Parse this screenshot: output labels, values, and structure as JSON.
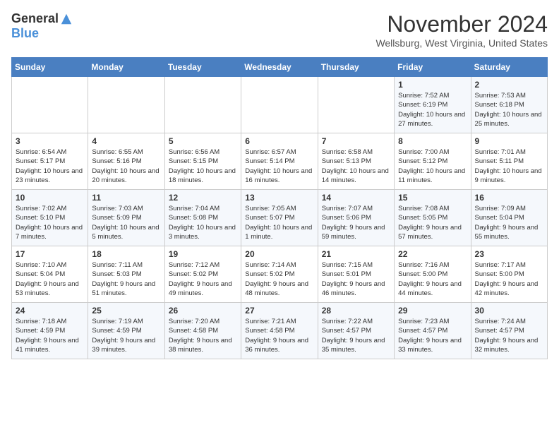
{
  "logo": {
    "general": "General",
    "blue": "Blue"
  },
  "header": {
    "month": "November 2024",
    "location": "Wellsburg, West Virginia, United States"
  },
  "weekdays": [
    "Sunday",
    "Monday",
    "Tuesday",
    "Wednesday",
    "Thursday",
    "Friday",
    "Saturday"
  ],
  "weeks": [
    [
      {
        "day": "",
        "info": ""
      },
      {
        "day": "",
        "info": ""
      },
      {
        "day": "",
        "info": ""
      },
      {
        "day": "",
        "info": ""
      },
      {
        "day": "",
        "info": ""
      },
      {
        "day": "1",
        "info": "Sunrise: 7:52 AM\nSunset: 6:19 PM\nDaylight: 10 hours and 27 minutes."
      },
      {
        "day": "2",
        "info": "Sunrise: 7:53 AM\nSunset: 6:18 PM\nDaylight: 10 hours and 25 minutes."
      }
    ],
    [
      {
        "day": "3",
        "info": "Sunrise: 6:54 AM\nSunset: 5:17 PM\nDaylight: 10 hours and 23 minutes."
      },
      {
        "day": "4",
        "info": "Sunrise: 6:55 AM\nSunset: 5:16 PM\nDaylight: 10 hours and 20 minutes."
      },
      {
        "day": "5",
        "info": "Sunrise: 6:56 AM\nSunset: 5:15 PM\nDaylight: 10 hours and 18 minutes."
      },
      {
        "day": "6",
        "info": "Sunrise: 6:57 AM\nSunset: 5:14 PM\nDaylight: 10 hours and 16 minutes."
      },
      {
        "day": "7",
        "info": "Sunrise: 6:58 AM\nSunset: 5:13 PM\nDaylight: 10 hours and 14 minutes."
      },
      {
        "day": "8",
        "info": "Sunrise: 7:00 AM\nSunset: 5:12 PM\nDaylight: 10 hours and 11 minutes."
      },
      {
        "day": "9",
        "info": "Sunrise: 7:01 AM\nSunset: 5:11 PM\nDaylight: 10 hours and 9 minutes."
      }
    ],
    [
      {
        "day": "10",
        "info": "Sunrise: 7:02 AM\nSunset: 5:10 PM\nDaylight: 10 hours and 7 minutes."
      },
      {
        "day": "11",
        "info": "Sunrise: 7:03 AM\nSunset: 5:09 PM\nDaylight: 10 hours and 5 minutes."
      },
      {
        "day": "12",
        "info": "Sunrise: 7:04 AM\nSunset: 5:08 PM\nDaylight: 10 hours and 3 minutes."
      },
      {
        "day": "13",
        "info": "Sunrise: 7:05 AM\nSunset: 5:07 PM\nDaylight: 10 hours and 1 minute."
      },
      {
        "day": "14",
        "info": "Sunrise: 7:07 AM\nSunset: 5:06 PM\nDaylight: 9 hours and 59 minutes."
      },
      {
        "day": "15",
        "info": "Sunrise: 7:08 AM\nSunset: 5:05 PM\nDaylight: 9 hours and 57 minutes."
      },
      {
        "day": "16",
        "info": "Sunrise: 7:09 AM\nSunset: 5:04 PM\nDaylight: 9 hours and 55 minutes."
      }
    ],
    [
      {
        "day": "17",
        "info": "Sunrise: 7:10 AM\nSunset: 5:04 PM\nDaylight: 9 hours and 53 minutes."
      },
      {
        "day": "18",
        "info": "Sunrise: 7:11 AM\nSunset: 5:03 PM\nDaylight: 9 hours and 51 minutes."
      },
      {
        "day": "19",
        "info": "Sunrise: 7:12 AM\nSunset: 5:02 PM\nDaylight: 9 hours and 49 minutes."
      },
      {
        "day": "20",
        "info": "Sunrise: 7:14 AM\nSunset: 5:02 PM\nDaylight: 9 hours and 48 minutes."
      },
      {
        "day": "21",
        "info": "Sunrise: 7:15 AM\nSunset: 5:01 PM\nDaylight: 9 hours and 46 minutes."
      },
      {
        "day": "22",
        "info": "Sunrise: 7:16 AM\nSunset: 5:00 PM\nDaylight: 9 hours and 44 minutes."
      },
      {
        "day": "23",
        "info": "Sunrise: 7:17 AM\nSunset: 5:00 PM\nDaylight: 9 hours and 42 minutes."
      }
    ],
    [
      {
        "day": "24",
        "info": "Sunrise: 7:18 AM\nSunset: 4:59 PM\nDaylight: 9 hours and 41 minutes."
      },
      {
        "day": "25",
        "info": "Sunrise: 7:19 AM\nSunset: 4:59 PM\nDaylight: 9 hours and 39 minutes."
      },
      {
        "day": "26",
        "info": "Sunrise: 7:20 AM\nSunset: 4:58 PM\nDaylight: 9 hours and 38 minutes."
      },
      {
        "day": "27",
        "info": "Sunrise: 7:21 AM\nSunset: 4:58 PM\nDaylight: 9 hours and 36 minutes."
      },
      {
        "day": "28",
        "info": "Sunrise: 7:22 AM\nSunset: 4:57 PM\nDaylight: 9 hours and 35 minutes."
      },
      {
        "day": "29",
        "info": "Sunrise: 7:23 AM\nSunset: 4:57 PM\nDaylight: 9 hours and 33 minutes."
      },
      {
        "day": "30",
        "info": "Sunrise: 7:24 AM\nSunset: 4:57 PM\nDaylight: 9 hours and 32 minutes."
      }
    ]
  ]
}
